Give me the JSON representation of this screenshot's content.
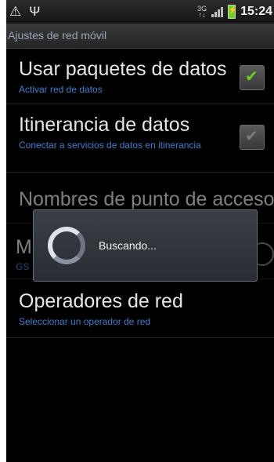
{
  "status_bar": {
    "left_icons": [
      "warning-icon",
      "usb-icon"
    ],
    "network_type": "3G",
    "time": "15:24"
  },
  "screen": {
    "title": "Ajustes de red móvil"
  },
  "settings": [
    {
      "title": "Usar paquetes de datos",
      "summary": "Activar red de datos",
      "checked": true
    },
    {
      "title": "Itinerancia de datos",
      "summary": "Conectar a servicios de datos en itinerancia",
      "checked": false
    },
    {
      "title": "Nombres de punto de acceso",
      "summary": ""
    },
    {
      "title": "M",
      "summary": "GS"
    },
    {
      "title": "Operadores de red",
      "summary": "Seleccionar un operador de red"
    }
  ],
  "dialog": {
    "message": "Buscando..."
  }
}
